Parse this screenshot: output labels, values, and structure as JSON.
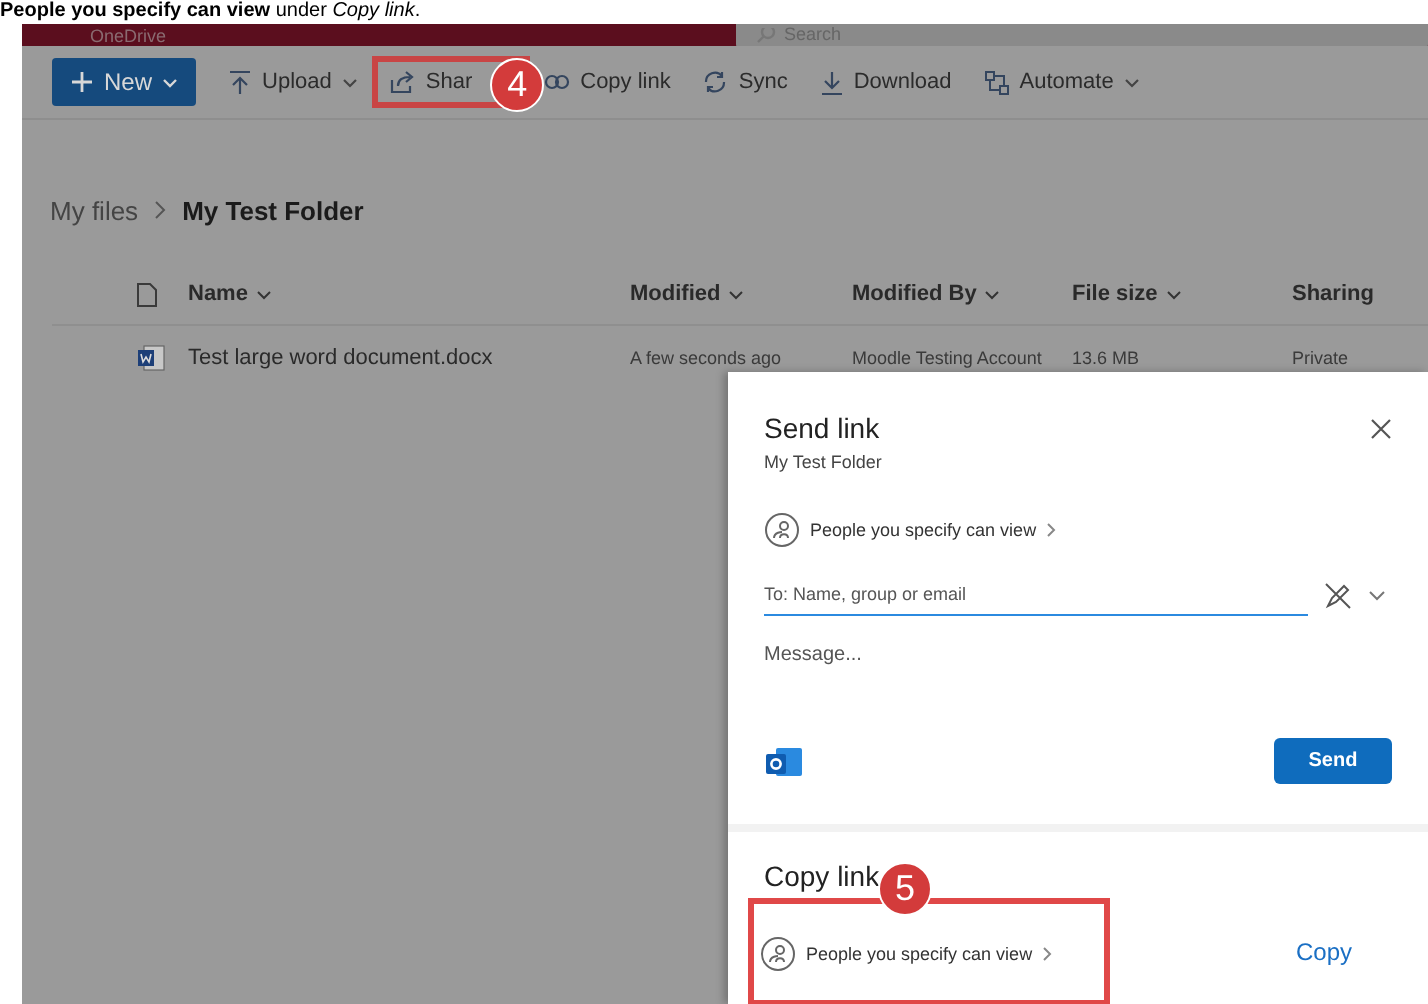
{
  "instruction": "**People you specify can view** under *Copy link*.",
  "header": {
    "app_name": "OneDrive",
    "search": {
      "placeholder": "Search"
    }
  },
  "toolbar": [
    {
      "label": "New",
      "kind": "primary"
    },
    {
      "label": "Upload",
      "kind": "menu"
    },
    {
      "label": "Shar",
      "kind": "plain",
      "callout": "4"
    },
    {
      "label": "Copy link",
      "kind": "plain"
    },
    {
      "label": "Sync",
      "kind": "plain"
    },
    {
      "label": "Download",
      "kind": "plain"
    },
    {
      "label": "Automate",
      "kind": "menu"
    }
  ],
  "breadcrumb": [
    "My files",
    "My Test Folder"
  ],
  "table": {
    "columns": [
      {
        "label": "Name",
        "sortable": true
      },
      {
        "label": "Modified",
        "sortable": true
      },
      {
        "label": "Modified By",
        "sortable": true
      },
      {
        "label": "File size",
        "sortable": true
      },
      {
        "label": "Sharing",
        "sortable": false
      }
    ],
    "rows": [
      {
        "name": "Test large word document.docx",
        "modified": "A few seconds ago",
        "modified_by": "Moodle Testing Account",
        "file_size": "13.6 MB",
        "sharing": "Private"
      }
    ]
  },
  "dialog": {
    "title": "Send link",
    "subtitle": "My Test Folder",
    "permission": "People you specify can view",
    "to_field": {
      "placeholder": "To: Name, group or email"
    },
    "message": {
      "placeholder": "Message..."
    },
    "send_button": "Send",
    "copy_section": {
      "title": "Copy link",
      "permission": "People you specify can view",
      "callout": "5",
      "copy_button": "Copy"
    }
  }
}
